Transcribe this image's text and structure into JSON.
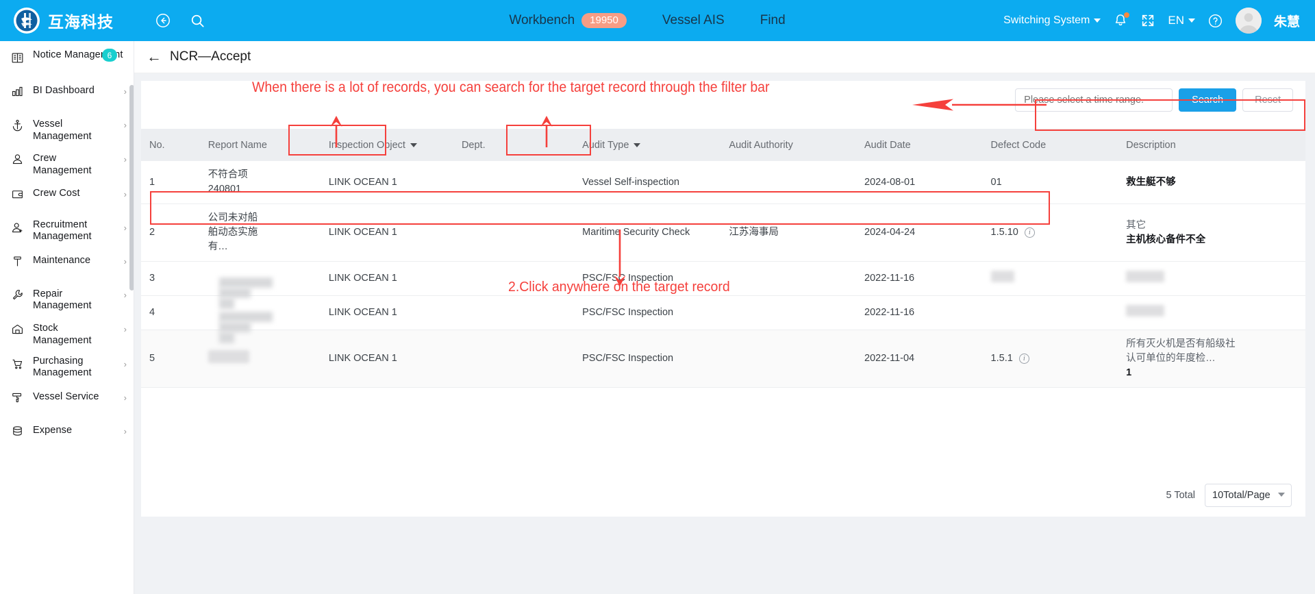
{
  "topbar": {
    "brand_name": "互海科技",
    "back_icon": "back-circle-icon",
    "search_icon": "search-icon",
    "workbench_label": "Workbench",
    "workbench_count": "19950",
    "vessel_ais_label": "Vessel AIS",
    "find_label": "Find",
    "switching_system_label": "Switching System",
    "bell_icon": "bell-icon",
    "fullscreen_icon": "fullscreen-icon",
    "language_label": "EN",
    "help_icon": "help-icon",
    "user_name": "朱慧"
  },
  "sidebar": {
    "items": [
      {
        "label": "Notice Management",
        "icon": "book-icon",
        "badge": "6",
        "chevron": false
      },
      {
        "label": "BI Dashboard",
        "icon": "bar-chart-icon",
        "badge": "",
        "chevron": true
      },
      {
        "label": "Vessel Management",
        "icon": "anchor-icon",
        "badge": "",
        "chevron": true
      },
      {
        "label": "Crew Management",
        "icon": "person-icon",
        "badge": "",
        "chevron": true
      },
      {
        "label": "Crew Cost",
        "icon": "wallet-icon",
        "badge": "",
        "chevron": true
      },
      {
        "label": "Recruitment Management",
        "icon": "person-add-icon",
        "badge": "",
        "chevron": true
      },
      {
        "label": "Maintenance",
        "icon": "hammer-icon",
        "badge": "",
        "chevron": true
      },
      {
        "label": "Repair Management",
        "icon": "wrench-icon",
        "badge": "",
        "chevron": true
      },
      {
        "label": "Stock Management",
        "icon": "warehouse-icon",
        "badge": "",
        "chevron": true
      },
      {
        "label": "Purchasing Management",
        "icon": "cart-icon",
        "badge": "",
        "chevron": true
      },
      {
        "label": "Vessel Service",
        "icon": "paint-roller-icon",
        "badge": "",
        "chevron": true
      },
      {
        "label": "Expense",
        "icon": "database-icon",
        "badge": "",
        "chevron": true
      }
    ]
  },
  "page": {
    "title": "NCR—Accept",
    "back_icon": "arrow-left-icon"
  },
  "filter": {
    "date_placeholder": "Please select a time range.",
    "search_label": "Search",
    "reset_label": "Reset"
  },
  "table": {
    "columns": [
      {
        "label": "No.",
        "filterable": false
      },
      {
        "label": "Report Name",
        "filterable": false
      },
      {
        "label": "Inspection Object",
        "filterable": true
      },
      {
        "label": "Dept.",
        "filterable": false
      },
      {
        "label": "Audit Type",
        "filterable": true
      },
      {
        "label": "Audit Authority",
        "filterable": false
      },
      {
        "label": "Audit Date",
        "filterable": false
      },
      {
        "label": "Defect Code",
        "filterable": false
      },
      {
        "label": "Description",
        "filterable": false
      }
    ],
    "rows": [
      {
        "no": "1",
        "report_name": "不符合项240801",
        "report_blurred": false,
        "inspection_object": "LINK OCEAN 1",
        "dept": "",
        "audit_type": "Vessel Self-inspection",
        "audit_authority": "",
        "audit_date": "2024-08-01",
        "defect_code": "01",
        "defect_info_icon": false,
        "defect_blurred": false,
        "description_top": "",
        "description_bold": "救生艇不够",
        "description_blurred": false,
        "highlighted": false
      },
      {
        "no": "2",
        "report_name": "公司未对船舶动态实施有…",
        "report_blurred": false,
        "inspection_object": "LINK OCEAN 1",
        "dept": "",
        "audit_type": "Maritime Security Check",
        "audit_authority": "江苏海事局",
        "audit_date": "2024-04-24",
        "defect_code": "1.5.10",
        "defect_info_icon": true,
        "defect_blurred": false,
        "description_top": "其它",
        "description_bold": "主机核心备件不全",
        "description_blurred": false,
        "highlighted": true
      },
      {
        "no": "3",
        "report_name": "",
        "report_blurred": true,
        "inspection_object": "LINK OCEAN 1",
        "dept": "",
        "audit_type": "PSC/FSC Inspection",
        "audit_authority": "",
        "audit_date": "2022-11-16",
        "defect_code": "",
        "defect_info_icon": false,
        "defect_blurred": true,
        "description_top": "",
        "description_bold": "",
        "description_blurred": true,
        "highlighted": false
      },
      {
        "no": "4",
        "report_name": "",
        "report_blurred": true,
        "inspection_object": "LINK OCEAN 1",
        "dept": "",
        "audit_type": "PSC/FSC Inspection",
        "audit_authority": "",
        "audit_date": "2022-11-16",
        "defect_code": "",
        "defect_info_icon": false,
        "defect_blurred": false,
        "description_top": "",
        "description_bold": "",
        "description_blurred": true,
        "highlighted": false
      },
      {
        "no": "5",
        "report_name": "",
        "report_blurred": true,
        "inspection_object": "LINK OCEAN 1",
        "dept": "",
        "audit_type": "PSC/FSC Inspection",
        "audit_authority": "",
        "audit_date": "2022-11-04",
        "defect_code": "1.5.1",
        "defect_info_icon": true,
        "defect_blurred": false,
        "description_top": "所有灭火机是否有船级社认可单位的年度检…",
        "description_bold": "1",
        "description_blurred": false,
        "highlighted": false
      }
    ]
  },
  "pagination": {
    "total_label": "5 Total",
    "page_size_label": "10Total/Page"
  },
  "annotations": {
    "note1": "When there is a lot of records, you can search for the target record through the filter bar",
    "note2": "2.Click anywhere on the target record",
    "accent_color": "#f5403c"
  }
}
